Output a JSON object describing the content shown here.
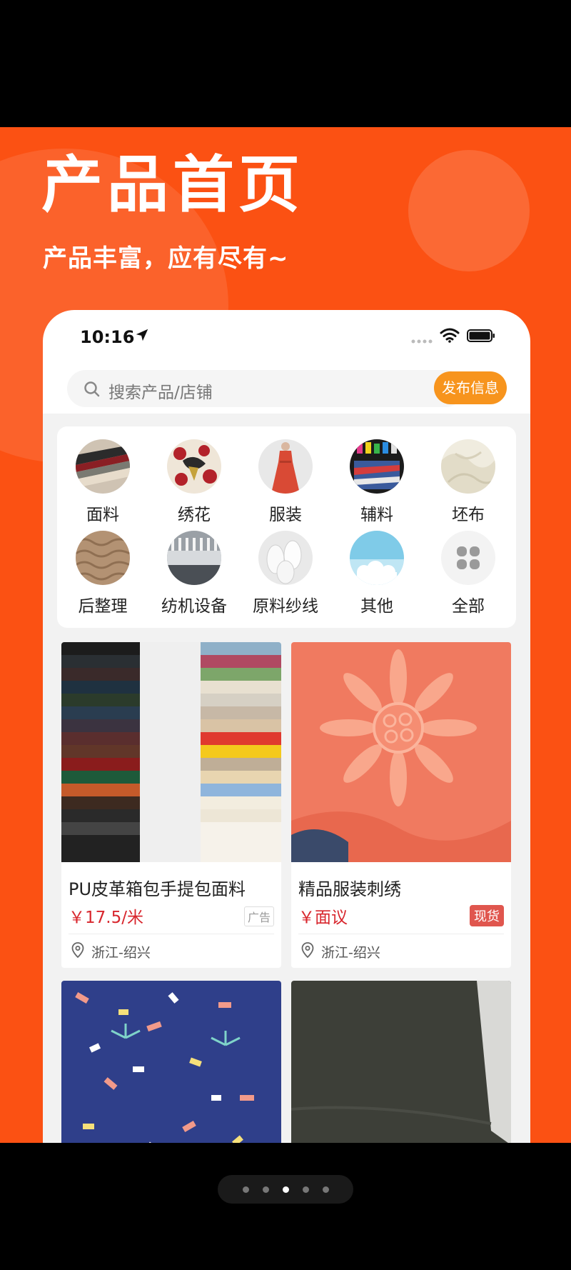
{
  "hero": {
    "title": "产品首页",
    "subtitle": "产品丰富，应有尽有~"
  },
  "status_bar": {
    "time": "10:16"
  },
  "search": {
    "placeholder": "搜索产品/店铺",
    "publish_label": "发布信息"
  },
  "categories": [
    {
      "label": "面料",
      "icon": "fabric-rolls-image"
    },
    {
      "label": "绣花",
      "icon": "embroidery-image"
    },
    {
      "label": "服装",
      "icon": "dress-image"
    },
    {
      "label": "辅料",
      "icon": "accessories-image"
    },
    {
      "label": "坯布",
      "icon": "greige-cloth-image"
    },
    {
      "label": "后整理",
      "icon": "finishing-image"
    },
    {
      "label": "纺机设备",
      "icon": "textile-machine-image"
    },
    {
      "label": "原料纱线",
      "icon": "yarn-image"
    },
    {
      "label": "其他",
      "icon": "other-cloud-image"
    },
    {
      "label": "全部",
      "icon": "grid-icon"
    }
  ],
  "products": [
    {
      "title": "PU皮革箱包手提包面料",
      "price": "￥17.5/米",
      "tag": "广告",
      "location": "浙江-绍兴"
    },
    {
      "title": "精品服装刺绣",
      "price": "￥面议",
      "tag": "现货",
      "location": "浙江-绍兴"
    },
    {
      "title": "",
      "price": "",
      "tag": "",
      "location": ""
    },
    {
      "title": "",
      "price": "",
      "tag": "",
      "location": ""
    }
  ],
  "pager": {
    "count": 5,
    "active_index": 2
  },
  "colors": {
    "brand_orange": "#fb5113",
    "publish_button": "#f7941d",
    "price_red": "#d8262d",
    "stock_tag": "#e0564e"
  }
}
